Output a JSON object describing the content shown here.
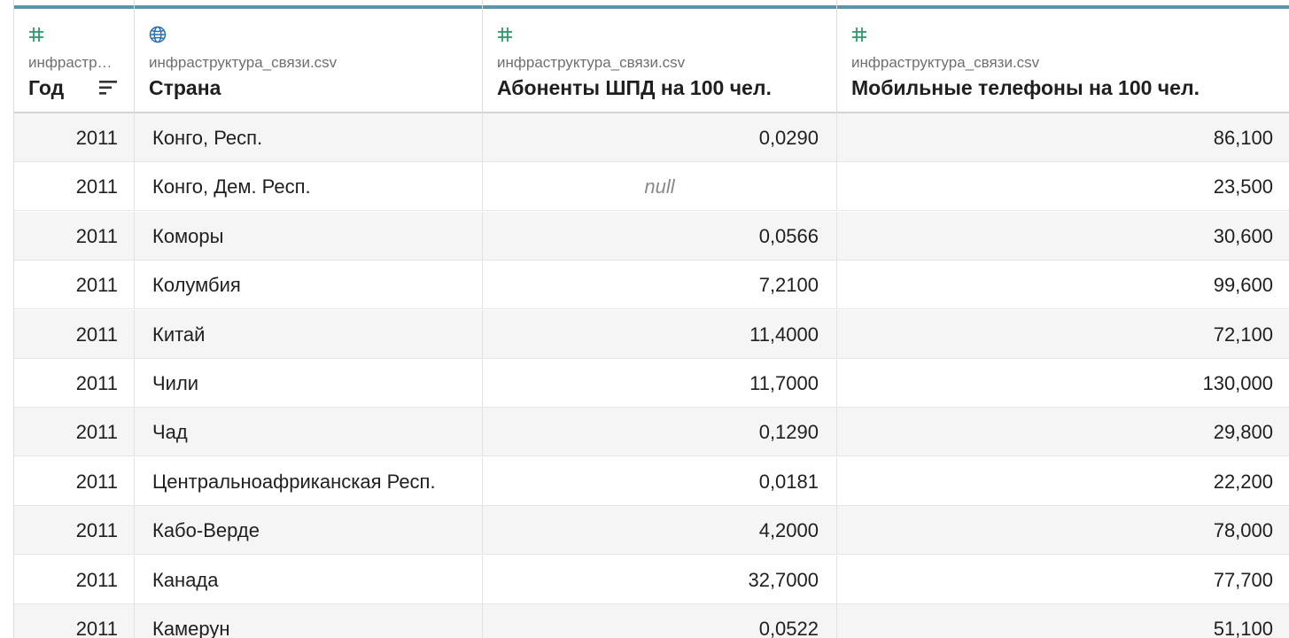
{
  "columns": [
    {
      "type_icon": "hash-icon",
      "source": "инфраструктура_связи.csv",
      "source_display": "инфрастр…",
      "name": "Год",
      "sorted": true
    },
    {
      "type_icon": "globe-icon",
      "source": "инфраструктура_связи.csv",
      "source_display": "инфраструктура_связи.csv",
      "name": "Страна",
      "sorted": false
    },
    {
      "type_icon": "hash-icon",
      "source": "инфраструктура_связи.csv",
      "source_display": "инфраструктура_связи.csv",
      "name": "Абоненты ШПД на 100 чел.",
      "sorted": false
    },
    {
      "type_icon": "hash-icon",
      "source": "инфраструктура_связи.csv",
      "source_display": "инфраструктура_связи.csv",
      "name": "Мобильные телефоны на 100 чел.",
      "sorted": false
    }
  ],
  "colors": {
    "header_bar": "#5b95a8",
    "hash_icon": "#2e9a6e",
    "globe_icon": "#2a6fb0",
    "stripe": "#f5f5f5",
    "null_text": "#8a8a8a"
  },
  "rows": [
    {
      "year": "2011",
      "country": "Конго, Респ.",
      "broadband": "0,0290",
      "mobile": "86,100"
    },
    {
      "year": "2011",
      "country": "Конго, Дем. Респ.",
      "broadband": "null",
      "mobile": "23,500"
    },
    {
      "year": "2011",
      "country": "Коморы",
      "broadband": "0,0566",
      "mobile": "30,600"
    },
    {
      "year": "2011",
      "country": "Колумбия",
      "broadband": "7,2100",
      "mobile": "99,600"
    },
    {
      "year": "2011",
      "country": "Китай",
      "broadband": "11,4000",
      "mobile": "72,100"
    },
    {
      "year": "2011",
      "country": "Чили",
      "broadband": "11,7000",
      "mobile": "130,000"
    },
    {
      "year": "2011",
      "country": "Чад",
      "broadband": "0,1290",
      "mobile": "29,800"
    },
    {
      "year": "2011",
      "country": "Центральноафриканская Респ.",
      "broadband": "0,0181",
      "mobile": "22,200"
    },
    {
      "year": "2011",
      "country": "Кабо-Верде",
      "broadband": "4,2000",
      "mobile": "78,000"
    },
    {
      "year": "2011",
      "country": "Канада",
      "broadband": "32,7000",
      "mobile": "77,700"
    },
    {
      "year": "2011",
      "country": "Камерун",
      "broadband": "0,0522",
      "mobile": "51,100"
    }
  ]
}
